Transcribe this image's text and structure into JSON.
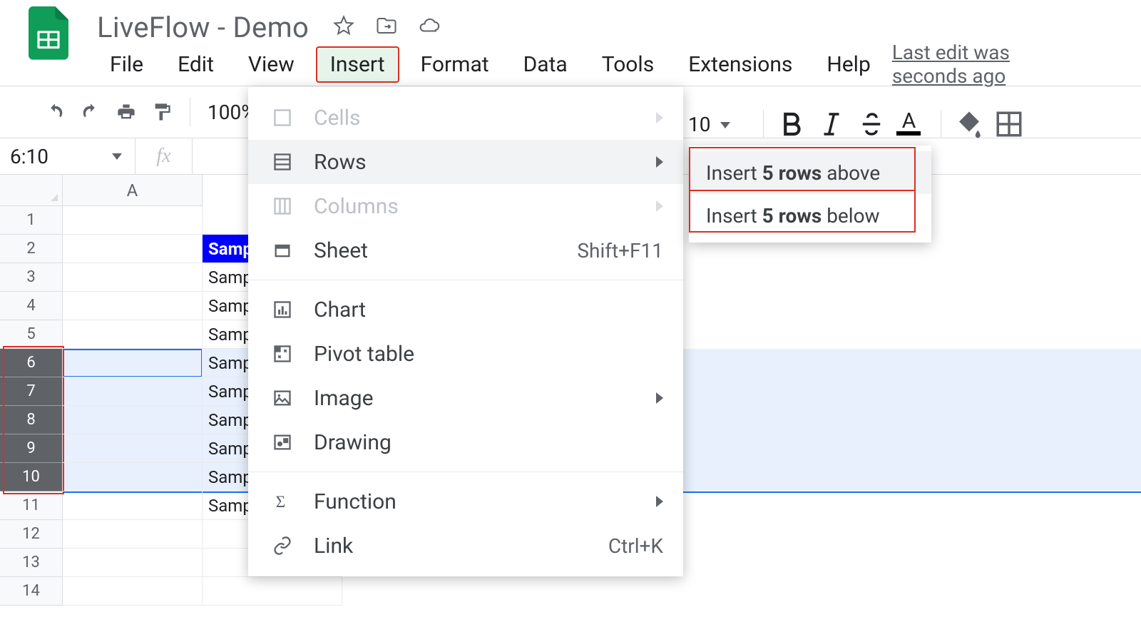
{
  "doc_title": "LiveFlow - Demo",
  "last_edit": "Last edit was seconds ago",
  "menus": {
    "file": "File",
    "edit": "Edit",
    "view": "View",
    "insert": "Insert",
    "format": "Format",
    "data": "Data",
    "tools": "Tools",
    "extensions": "Extensions",
    "help": "Help"
  },
  "toolbar": {
    "zoom": "100%",
    "font_size": "10"
  },
  "name_box": "6:10",
  "columns": [
    "A"
  ],
  "rows": [
    "1",
    "2",
    "3",
    "4",
    "5",
    "6",
    "7",
    "8",
    "9",
    "10",
    "11",
    "12",
    "13",
    "14"
  ],
  "selected_rows": [
    "6",
    "7",
    "8",
    "9",
    "10"
  ],
  "cells": {
    "B2": "Samp",
    "B3": "Samp",
    "B4": "Samp",
    "B5": "Samp",
    "B6": "Samp",
    "B7": "Samp",
    "B8": "Samp",
    "B9": "Samp",
    "B10": "Samp",
    "B11": "Samp"
  },
  "insert_menu": {
    "cells": "Cells",
    "rows": "Rows",
    "columns": "Columns",
    "sheet": "Sheet",
    "sheet_shortcut": "Shift+F11",
    "chart": "Chart",
    "pivot": "Pivot table",
    "image": "Image",
    "drawing": "Drawing",
    "function": "Function",
    "link": "Link",
    "link_shortcut": "Ctrl+K"
  },
  "rows_submenu": {
    "above_pre": "Insert ",
    "above_bold": "5 rows",
    "above_post": " above",
    "below_pre": "Insert ",
    "below_bold": "5 rows",
    "below_post": " below"
  }
}
